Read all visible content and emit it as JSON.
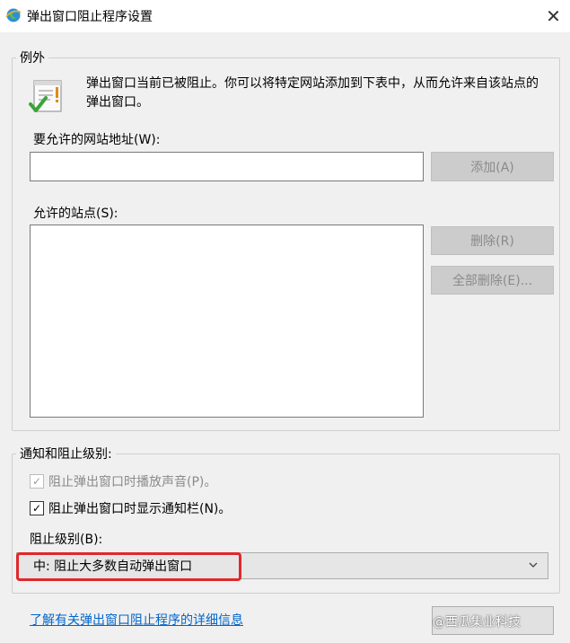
{
  "window": {
    "title": "弹出窗口阻止程序设置",
    "close_glyph": "✕"
  },
  "exceptions": {
    "legend": "例外",
    "info_text": "弹出窗口当前已被阻止。你可以将特定网站添加到下表中，从而允许来自该站点的弹出窗口。",
    "url_label": "要允许的网站地址(W):",
    "url_value": "",
    "add_label": "添加(A)",
    "sites_label": "允许的站点(S):",
    "sites": [],
    "remove_label": "删除(R)",
    "remove_all_label": "全部删除(E)..."
  },
  "notifications": {
    "legend": "通知和阻止级别:",
    "sound_label": "阻止弹出窗口时播放声音(P)。",
    "sound_checked": true,
    "sound_disabled": true,
    "bar_label": "阻止弹出窗口时显示通知栏(N)。",
    "bar_checked": true,
    "level_label": "阻止级别(B):",
    "level_selected": "中: 阻止大多数自动弹出窗口"
  },
  "footer": {
    "help_link": "了解有关弹出窗口阻止程序的详细信息",
    "watermark": "@西瓜集业科技"
  },
  "colors": {
    "highlight": "#e0282c",
    "link": "#0066cc",
    "background": "#f0f0f0"
  },
  "icons": {
    "app": "ie-globe-icon",
    "info": "clipboard-check-icon",
    "close": "close-icon",
    "dropdown": "chevron-down-icon",
    "checkbox": "check-icon"
  }
}
